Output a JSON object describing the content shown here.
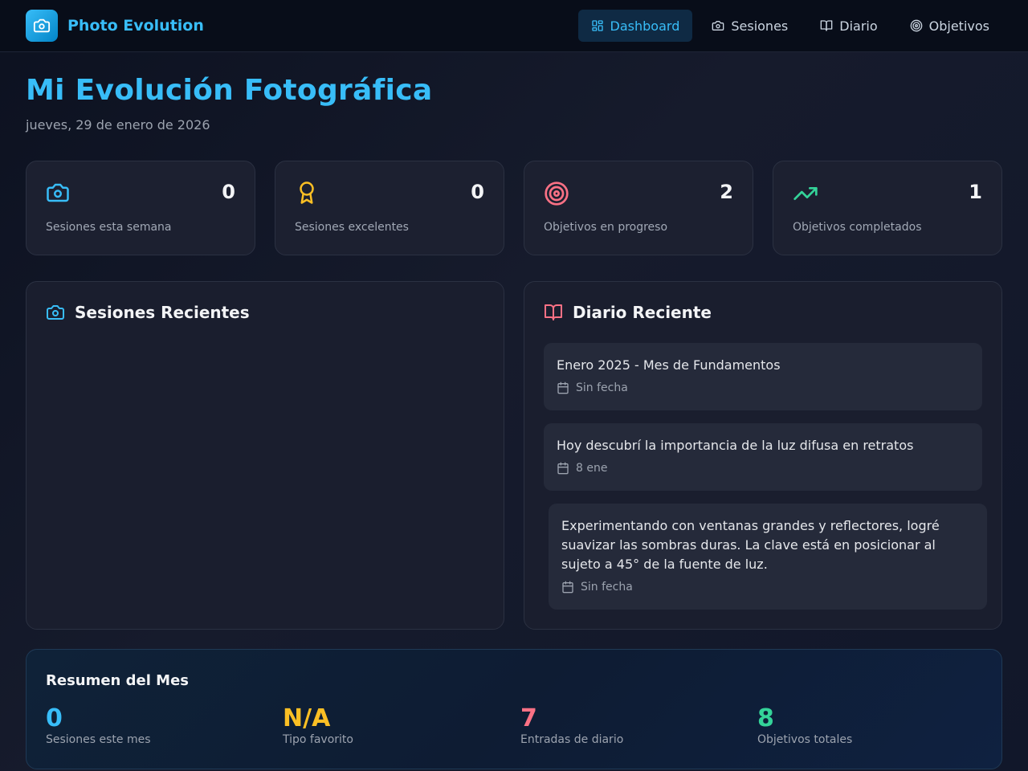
{
  "app": {
    "name": "Photo Evolution",
    "accent": "#38bdf8"
  },
  "nav": [
    {
      "label": "Dashboard",
      "icon": "grid-icon",
      "active": true
    },
    {
      "label": "Sesiones",
      "icon": "camera-icon",
      "active": false
    },
    {
      "label": "Diario",
      "icon": "book-icon",
      "active": false
    },
    {
      "label": "Objetivos",
      "icon": "target-icon",
      "active": false
    }
  ],
  "page": {
    "title": "Mi Evolución Fotográfica",
    "date": "jueves, 29 de enero de 2026"
  },
  "stats": [
    {
      "value": "0",
      "label": "Sesiones esta semana",
      "icon": "camera-icon",
      "color": "#38bdf8"
    },
    {
      "value": "0",
      "label": "Sesiones excelentes",
      "icon": "award-icon",
      "color": "#fbbf24"
    },
    {
      "value": "2",
      "label": "Objetivos en progreso",
      "icon": "target-icon",
      "color": "#fb7185"
    },
    {
      "value": "1",
      "label": "Objetivos completados",
      "icon": "trending-up-icon",
      "color": "#34d399"
    }
  ],
  "sessions_panel": {
    "title": "Sesiones Recientes"
  },
  "journal_panel": {
    "title": "Diario Reciente",
    "entries": [
      {
        "text": "Enero 2025 - Mes de Fundamentos",
        "date": "Sin fecha"
      },
      {
        "text": "Hoy descubrí la importancia de la luz difusa en retratos",
        "date": "8 ene"
      },
      {
        "text": "Experimentando con ventanas grandes y reflectores, logré suavizar las sombras duras. La clave está en posicionar al sujeto a 45° de la fuente de luz.",
        "date": "Sin fecha"
      }
    ]
  },
  "summary": {
    "title": "Resumen del Mes",
    "items": [
      {
        "value": "0",
        "label": "Sesiones este mes",
        "color": "#38bdf8"
      },
      {
        "value": "N/A",
        "label": "Tipo favorito",
        "color": "#fbbf24"
      },
      {
        "value": "7",
        "label": "Entradas de diario",
        "color": "#fb7185"
      },
      {
        "value": "8",
        "label": "Objetivos totales",
        "color": "#34d399"
      }
    ]
  }
}
